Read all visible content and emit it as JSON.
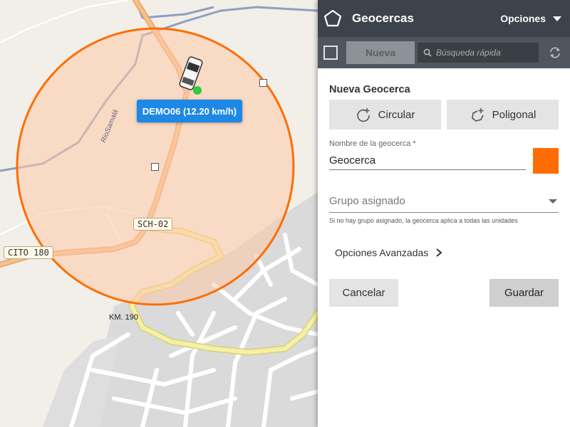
{
  "map": {
    "vehicle_label": "DEMO06 (12.20 km/h)",
    "road_labels": {
      "sch02": "SCH-02",
      "cito": "CITO 180"
    },
    "place_label": "KM. 190",
    "river_label": "RioSamalá",
    "geofence_color": "#ff6d00",
    "geofence_fill": "#ffc9a8",
    "vehicle_status_color": "#2ecc40"
  },
  "panel": {
    "header": {
      "title": "Geocercas",
      "options_label": "Opciones"
    },
    "toolbar": {
      "new_label": "Nueva",
      "search_placeholder": "Búsqueda rápida"
    },
    "form": {
      "title": "Nueva Geocerca",
      "circular_label": "Circular",
      "polygonal_label": "Poligonal",
      "name_label": "Nombre de la geocerca *",
      "name_value": "Geocerca",
      "color": "#ff6d00",
      "group_placeholder": "Grupo asignado",
      "group_hint": "Si no hay grupo asignado, la geocerca aplica a todas las unidades",
      "advanced_label": "Opciones Avanzadas",
      "cancel_label": "Cancelar",
      "save_label": "Guardar"
    },
    "colors": {
      "header_bg": "#3d434b",
      "toolbar_bg": "#50565e",
      "accent": "#ff6d00"
    }
  }
}
